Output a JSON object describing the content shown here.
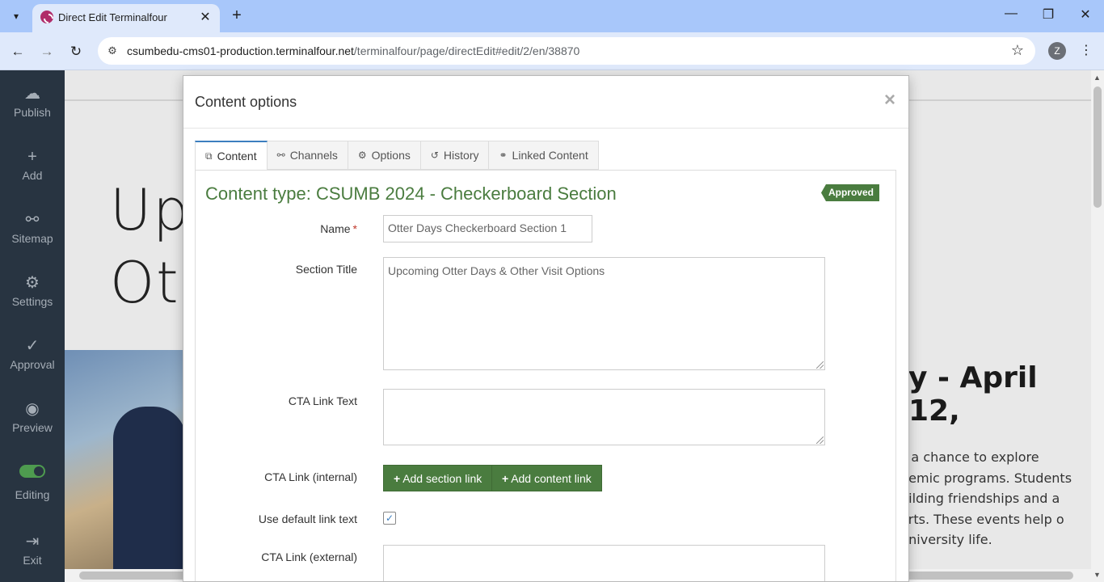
{
  "browser": {
    "tab_title": "Direct Edit Terminalfour",
    "url_host": "csumbedu-cms01-production.terminalfour.net",
    "url_path": "/terminalfour/page/directEdit#edit/2/en/38870",
    "profile_initial": "Z"
  },
  "sidebar": {
    "publish": "Publish",
    "add": "Add",
    "sitemap": "Sitemap",
    "settings": "Settings",
    "approval": "Approval",
    "preview": "Preview",
    "editing": "Editing",
    "exit": "Exit"
  },
  "background": {
    "heading_line1": "Up",
    "heading_line2": "Ot",
    "right_heading": "y - April 12,",
    "right_text": "s a chance to explore demic programs. Students uilding friendships and a arts. These events help o university life."
  },
  "modal": {
    "title": "Content options",
    "close": "×",
    "tabs": [
      "Content",
      "Channels",
      "Options",
      "History",
      "Linked Content"
    ],
    "content_type": "Content type: CSUMB 2024 - Checkerboard Section",
    "status_badge": "Approved",
    "fields": {
      "name_label": "Name",
      "name_required": "*",
      "name_value": "Otter Days Checkerboard Section 1",
      "section_title_label": "Section Title",
      "section_title_value": "Upcoming Otter Days & Other Visit Options",
      "cta_text_label": "CTA Link Text",
      "cta_text_value": "",
      "cta_internal_label": "CTA Link (internal)",
      "add_section_link": "Add section link",
      "add_content_link": "Add content link",
      "default_link_label": "Use default link text",
      "default_link_checked": true,
      "cta_external_label": "CTA Link (external)",
      "cta_external_value": ""
    }
  }
}
